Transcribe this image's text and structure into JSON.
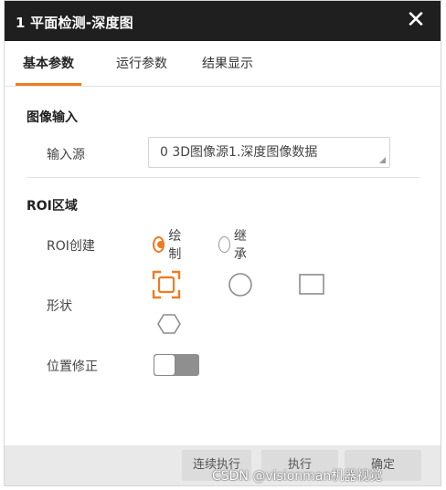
{
  "window": {
    "title": "1 平面检测-深度图",
    "close_glyph": "✕"
  },
  "tabs": [
    {
      "label": "基本参数",
      "active": true
    },
    {
      "label": "运行参数",
      "active": false
    },
    {
      "label": "结果显示",
      "active": false
    }
  ],
  "image_input": {
    "section_title": "图像输入",
    "source_label": "输入源",
    "source_value": "0 3D图像源1.深度图像数据"
  },
  "roi": {
    "section_title": "ROI区域",
    "create_label": "ROI创建",
    "create_options": [
      {
        "label": "绘制",
        "checked": true
      },
      {
        "label": "继承",
        "checked": false
      }
    ],
    "shape_label": "形状",
    "shapes": [
      {
        "icon": "full-image-rect-icon",
        "selected": true
      },
      {
        "icon": "circle-icon",
        "selected": false
      },
      {
        "icon": "rectangle-icon",
        "selected": false
      },
      {
        "icon": "polygon-icon",
        "selected": false
      }
    ],
    "position_correction_label": "位置修正",
    "position_correction_on": false
  },
  "footer": {
    "buttons": [
      "连续执行",
      "执行",
      "确定"
    ]
  },
  "watermark": "CSDN @visionman机器视觉",
  "colors": {
    "accent": "#f07b1f",
    "titlebar": "#1f1f1f",
    "footer": "#e9e9e9"
  }
}
